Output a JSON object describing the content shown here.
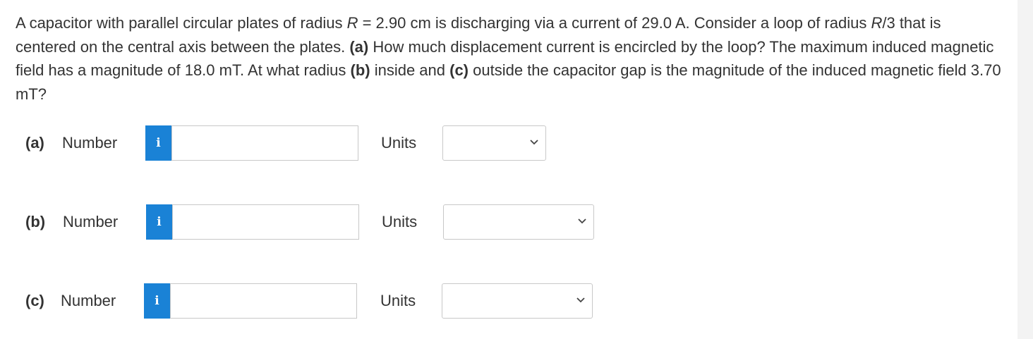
{
  "question": {
    "intro": "A capacitor with parallel circular plates of radius ",
    "var_R": "R",
    "eq_R": " = 2.90 cm is discharging via a current of 29.0 A. Consider a loop of radius ",
    "var_R2": "R",
    "loop_frac": "/3 that is centered on the central axis between the plates. ",
    "part_a_tag": "(a)",
    "part_a_text": " How much displacement current is encircled by the loop? The maximum induced magnetic field has a magnitude of 18.0 mT. At what radius ",
    "part_b_tag": "(b)",
    "part_b_text": " inside and ",
    "part_c_tag": "(c)",
    "part_c_text": " outside the capacitor gap is the magnitude of the induced magnetic field 3.70 mT?"
  },
  "answers": [
    {
      "part": "(a)",
      "number_label": "Number",
      "info_icon": "i",
      "value": "",
      "units_label": "Units",
      "units_selected": ""
    },
    {
      "part": "(b)",
      "number_label": "Number",
      "info_icon": "i",
      "value": "",
      "units_label": "Units",
      "units_selected": ""
    },
    {
      "part": "(c)",
      "number_label": "Number",
      "info_icon": "i",
      "value": "",
      "units_label": "Units",
      "units_selected": ""
    }
  ],
  "colors": {
    "info_button": "#1a82d6",
    "text": "#333333",
    "input_border": "#c8c8c8"
  },
  "icons": {
    "info": "info-icon",
    "dropdown": "chevron-down-icon"
  }
}
